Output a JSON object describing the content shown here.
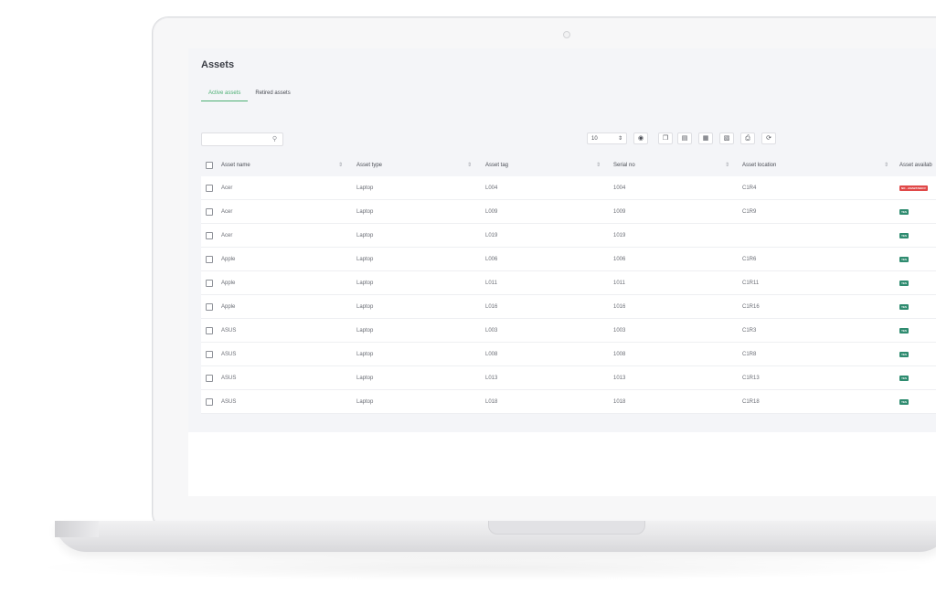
{
  "page": {
    "title": "Assets"
  },
  "tabs": [
    {
      "label": "Active assets"
    },
    {
      "label": "Retired assets"
    }
  ],
  "search": {
    "placeholder": "",
    "icon": "search-icon"
  },
  "toolbar": {
    "page_size": "10",
    "icons": [
      "eye-icon",
      "copy-icon",
      "csv-icon",
      "excel-icon",
      "pdf-icon",
      "print-icon",
      "refresh-icon"
    ]
  },
  "table": {
    "columns": [
      "Asset name",
      "Asset type",
      "Asset tag",
      "Serial no",
      "Asset location",
      "Asset availab"
    ],
    "rows": [
      {
        "name": "Acer",
        "type": "Laptop",
        "tag": "L004",
        "serial": "1004",
        "location": "C1R4",
        "availability": "NO - ANABTAIEN F",
        "status": "no"
      },
      {
        "name": "Acer",
        "type": "Laptop",
        "tag": "L009",
        "serial": "1009",
        "location": "C1R9",
        "availability": "YES",
        "status": "yes"
      },
      {
        "name": "Acer",
        "type": "Laptop",
        "tag": "L019",
        "serial": "1019",
        "location": "",
        "availability": "YES",
        "status": "yes"
      },
      {
        "name": "Apple",
        "type": "Laptop",
        "tag": "L006",
        "serial": "1006",
        "location": "C1R6",
        "availability": "YES",
        "status": "yes"
      },
      {
        "name": "Apple",
        "type": "Laptop",
        "tag": "L011",
        "serial": "1011",
        "location": "C1R11",
        "availability": "YES",
        "status": "yes"
      },
      {
        "name": "Apple",
        "type": "Laptop",
        "tag": "L016",
        "serial": "1016",
        "location": "C1R16",
        "availability": "YES",
        "status": "yes"
      },
      {
        "name": "ASUS",
        "type": "Laptop",
        "tag": "L003",
        "serial": "1003",
        "location": "C1R3",
        "availability": "YES",
        "status": "yes"
      },
      {
        "name": "ASUS",
        "type": "Laptop",
        "tag": "L008",
        "serial": "1008",
        "location": "C1R8",
        "availability": "YES",
        "status": "yes"
      },
      {
        "name": "ASUS",
        "type": "Laptop",
        "tag": "L013",
        "serial": "1013",
        "location": "C1R13",
        "availability": "YES",
        "status": "yes"
      },
      {
        "name": "ASUS",
        "type": "Laptop",
        "tag": "L018",
        "serial": "1018",
        "location": "C1R18",
        "availability": "YES",
        "status": "yes"
      }
    ]
  },
  "colors": {
    "accent": "#4caf73",
    "yes_badge": "#2e8b6f",
    "no_badge": "#e04848"
  }
}
